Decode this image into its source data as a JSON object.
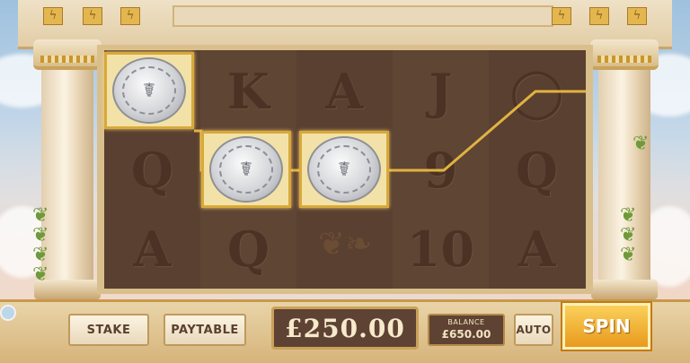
{
  "reels": {
    "columns": [
      {
        "symbols": [
          "coin",
          "Q",
          "A"
        ]
      },
      {
        "symbols": [
          "K",
          "coin",
          "Q"
        ]
      },
      {
        "symbols": [
          "A",
          "coin",
          "laurel"
        ]
      },
      {
        "symbols": [
          "J",
          "9",
          "10"
        ]
      },
      {
        "symbols": [
          "ring",
          "Q",
          "A"
        ]
      }
    ],
    "win_symbol": "scroll-coin-icon",
    "payline_color": "#e1b341"
  },
  "controls": {
    "stake_label": "STAKE",
    "paytable_label": "PAYTABLE",
    "stake_value": "£250.00",
    "balance_label": "BALANCE",
    "balance_value": "£650.00",
    "auto_label": "AUTO",
    "spin_label": "SPIN"
  },
  "theme": {
    "gold": "#d8a93a",
    "reel_bg": "#5a4030",
    "marble": "#f3e6cc"
  }
}
